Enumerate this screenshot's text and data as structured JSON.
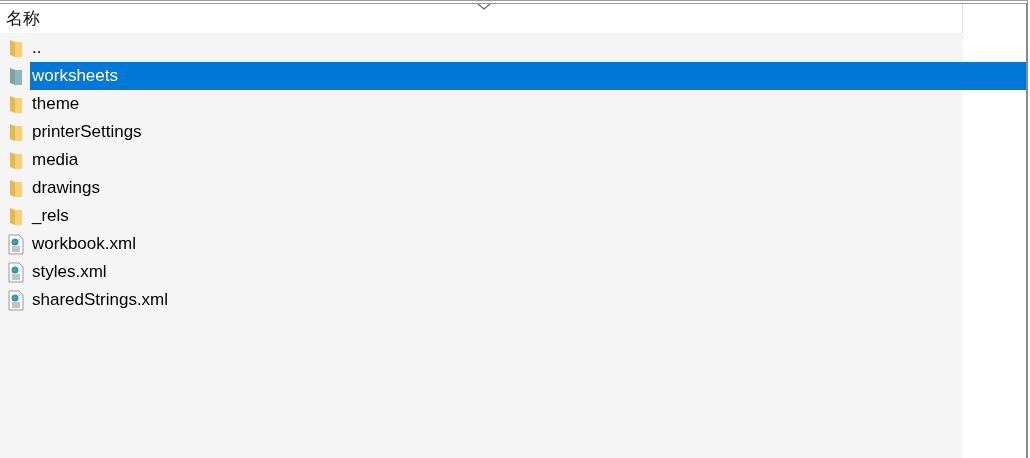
{
  "header": {
    "name_column": "名称"
  },
  "items": [
    {
      "name": "..",
      "kind": "folder",
      "selected": false
    },
    {
      "name": "worksheets",
      "kind": "folder",
      "selected": true
    },
    {
      "name": "theme",
      "kind": "folder",
      "selected": false
    },
    {
      "name": "printerSettings",
      "kind": "folder",
      "selected": false
    },
    {
      "name": "media",
      "kind": "folder",
      "selected": false
    },
    {
      "name": "drawings",
      "kind": "folder",
      "selected": false
    },
    {
      "name": "_rels",
      "kind": "folder",
      "selected": false
    },
    {
      "name": "workbook.xml",
      "kind": "file",
      "selected": false
    },
    {
      "name": "styles.xml",
      "kind": "file",
      "selected": false
    },
    {
      "name": "sharedStrings.xml",
      "kind": "file",
      "selected": false
    }
  ]
}
